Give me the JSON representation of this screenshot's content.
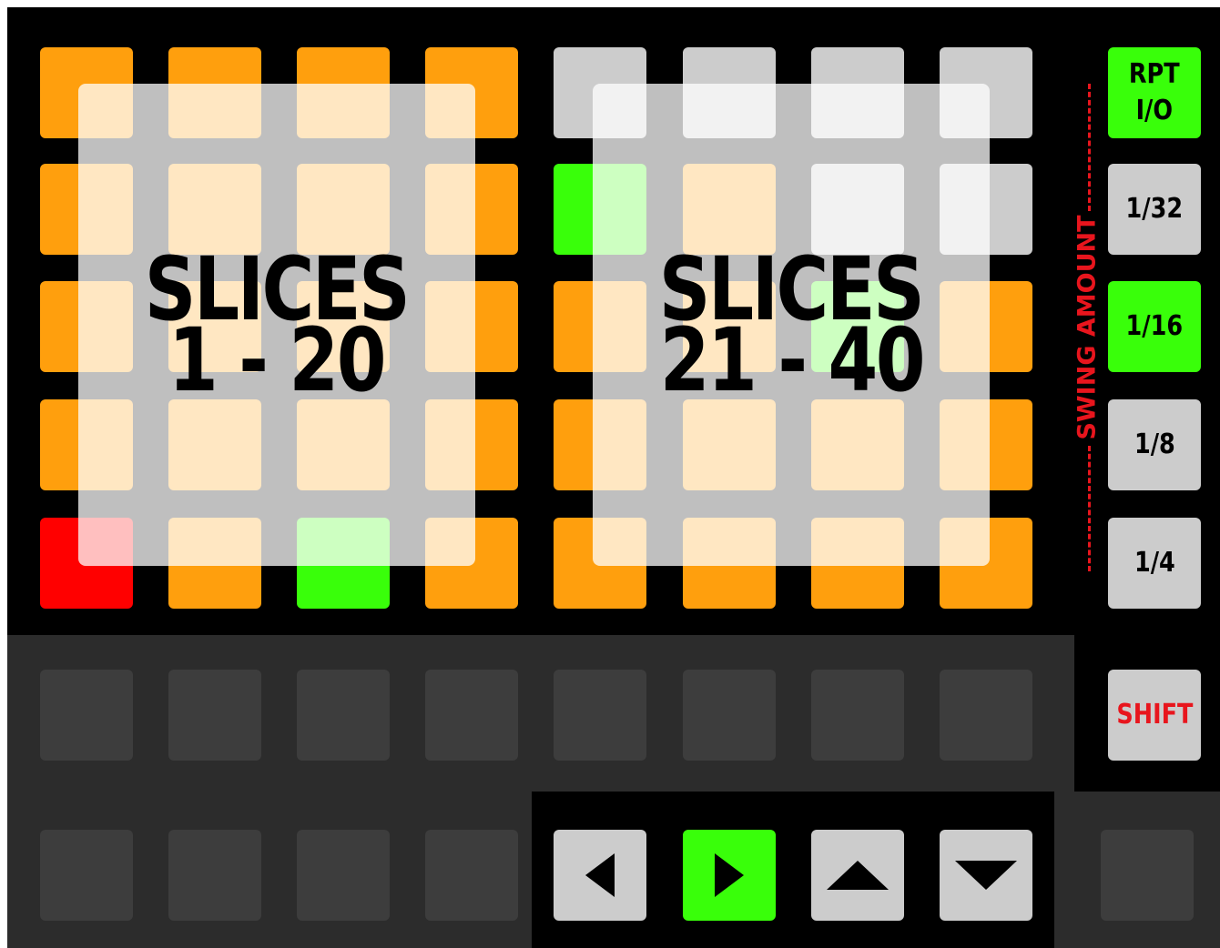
{
  "colors": {
    "orange": "#ff9f0d",
    "light_gray": "#cccccc",
    "green": "#39ff0a",
    "red": "#ff0000",
    "dark_pad": "#3d3d3d",
    "dark_panel": "#2c2c2c",
    "swing_red": "#e8151d",
    "shift_red": "#e8151d",
    "black": "#000000"
  },
  "main_grid": {
    "rows": [
      [
        "orange",
        "orange",
        "orange",
        "orange",
        "light_gray",
        "light_gray",
        "light_gray",
        "light_gray"
      ],
      [
        "orange",
        "orange",
        "orange",
        "orange",
        "green",
        "orange",
        "light_gray",
        "light_gray"
      ],
      [
        "orange",
        "orange",
        "orange",
        "orange",
        "orange",
        "orange",
        "green",
        "orange"
      ],
      [
        "orange",
        "orange",
        "orange",
        "orange",
        "orange",
        "orange",
        "orange",
        "orange"
      ],
      [
        "red",
        "orange",
        "green",
        "orange",
        "orange",
        "orange",
        "orange",
        "orange"
      ]
    ]
  },
  "overlays": [
    {
      "line1": "SLICES",
      "line2": "1 - 20"
    },
    {
      "line1": "SLICES",
      "line2": "21 - 40"
    }
  ],
  "side_buttons": [
    {
      "lines": [
        "RPT",
        "I/O"
      ],
      "color": "green"
    },
    {
      "lines": [
        "1/32"
      ],
      "color": "light_gray"
    },
    {
      "lines": [
        "1/16"
      ],
      "color": "green"
    },
    {
      "lines": [
        "1/8"
      ],
      "color": "light_gray"
    },
    {
      "lines": [
        "1/4"
      ],
      "color": "light_gray"
    }
  ],
  "swing_label": "SWING AMOUNT",
  "shift_label": "SHIFT",
  "arrow_buttons": [
    {
      "icon": "arrow-left-icon",
      "dir": "left",
      "color": "light_gray"
    },
    {
      "icon": "arrow-right-icon",
      "dir": "right",
      "color": "green"
    },
    {
      "icon": "arrow-up-icon",
      "dir": "up",
      "color": "light_gray"
    },
    {
      "icon": "arrow-down-icon",
      "dir": "down",
      "color": "light_gray"
    }
  ]
}
